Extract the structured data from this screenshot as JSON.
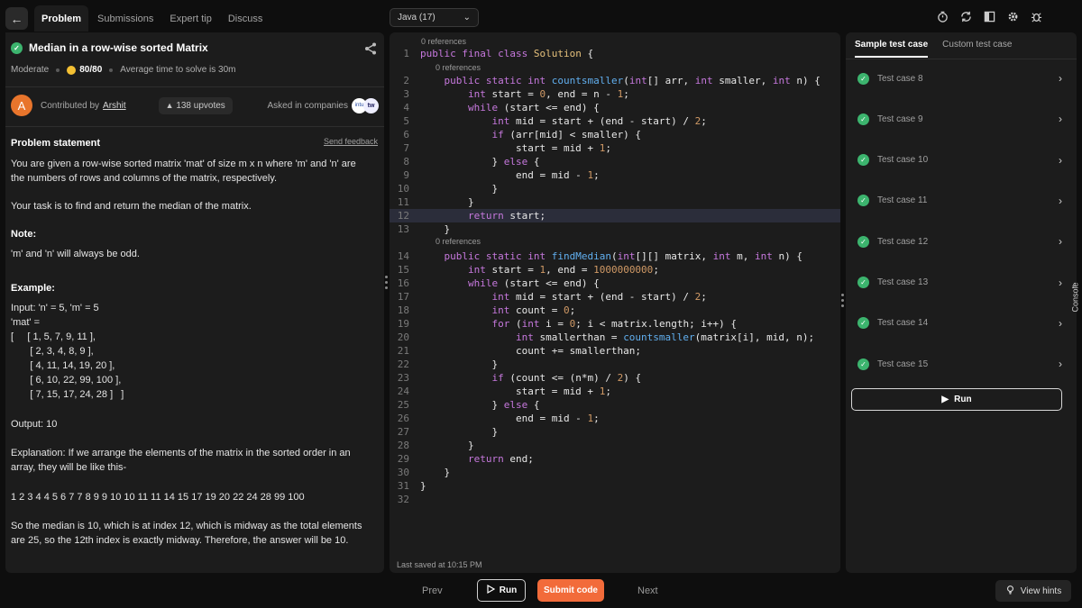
{
  "tabs": [
    "Problem",
    "Submissions",
    "Expert tip",
    "Discuss"
  ],
  "language": "Java (17)",
  "problem": {
    "title": "Median in a row-wise sorted Matrix",
    "difficulty": "Moderate",
    "score": "80/80",
    "avg_time": "Average time to solve is 30m",
    "contributed_by": "Contributed by",
    "author": "Arshit",
    "author_initial": "A",
    "upvotes": "138 upvotes",
    "asked_in": "Asked in companies",
    "company_logos": [
      "intu",
      "tw"
    ],
    "statement_heading": "Problem statement",
    "send_feedback": "Send feedback",
    "lines": [
      "You are given a row-wise sorted matrix 'mat' of size m x n where 'm' and 'n' are",
      "the numbers of rows and columns of the matrix, respectively.",
      "Your task is to find and return the median of the matrix.",
      "Note:",
      "'m' and 'n' will always be odd.",
      "Example:",
      "Input: 'n' = 5, 'm' = 5",
      "'mat' =",
      "[     [ 1, 5, 7, 9, 11 ],",
      "       [ 2, 3, 4, 8, 9 ],",
      "       [ 4, 11, 14, 19, 20 ],",
      "       [ 6, 10, 22, 99, 100 ],",
      "       [ 7, 15, 17, 24, 28 ]   ]",
      "Output: 10",
      "Explanation: If we arrange the elements of the matrix in the sorted order in an",
      "array, they will be like this-",
      "1 2 3 4 4 5 6 7 7 8 9 9 10 10 11 11 14 15 17 19 20 22 24 28 99 100",
      "So the median is 10, which is at index 12, which is midway as the total elements",
      "are 25, so the 12th index is exactly midway. Therefore, the answer will be 10."
    ]
  },
  "editor": {
    "references": [
      "0 references",
      "0 references",
      "0 references"
    ],
    "code": [
      "public final class Solution {",
      "    public static int countsmaller(int[] arr, int smaller, int n) {",
      "        int start = 0, end = n - 1;",
      "        while (start <= end) {",
      "            int mid = start + (end - start) / 2;",
      "            if (arr[mid] < smaller) {",
      "                start = mid + 1;",
      "            } else {",
      "                end = mid - 1;",
      "            }",
      "        }",
      "        return start;",
      "    }",
      "    public static int findMedian(int[][] matrix, int m, int n) {",
      "        int start = 1, end = 1000000000;",
      "        while (start <= end) {",
      "            int mid = start + (end - start) / 2;",
      "            int count = 0;",
      "            for (int i = 0; i < matrix.length; i++) {",
      "                int smallerthan = countsmaller(matrix[i], mid, n);",
      "                count += smallerthan;",
      "            }",
      "            if (count <= (n*m) / 2) {",
      "                start = mid + 1;",
      "            } else {",
      "                end = mid - 1;",
      "            }",
      "        }",
      "        return end;",
      "    }",
      "}",
      ""
    ],
    "saved": "Last saved at 10:15 PM"
  },
  "right": {
    "tabs": [
      "Sample test case",
      "Custom test case"
    ],
    "test_cases": [
      "Test case 8",
      "Test case 9",
      "Test case 10",
      "Test case 11",
      "Test case 12",
      "Test case 13",
      "Test case 14",
      "Test case 15"
    ],
    "run": "Run",
    "console": "Console"
  },
  "footer": {
    "prev": "Prev",
    "run": "Run",
    "submit": "Submit code",
    "next": "Next",
    "hints": "View hints"
  }
}
